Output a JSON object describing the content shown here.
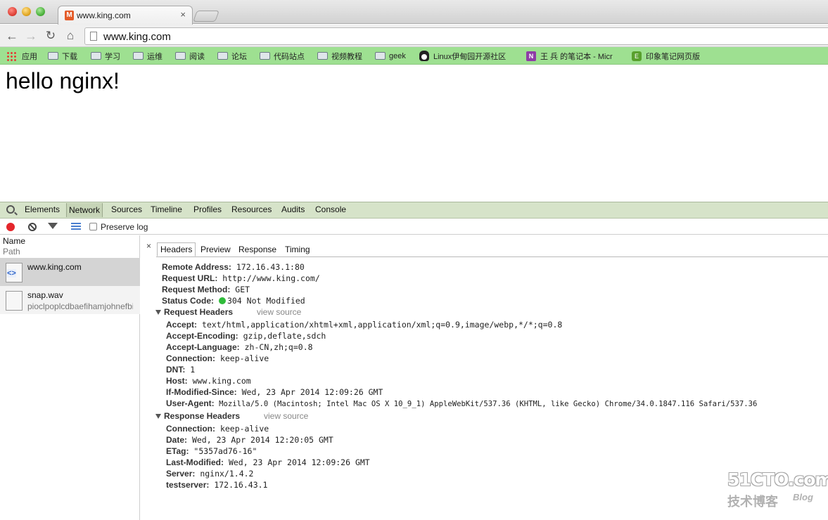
{
  "browser": {
    "tab_title": "www.king.com",
    "tab_close": "×",
    "url": "www.king.com"
  },
  "bookmarks": [
    {
      "label": "应用",
      "icon": "apps-grid-icon"
    },
    {
      "label": "下载",
      "icon": "folder-icon"
    },
    {
      "label": "学习",
      "icon": "folder-icon"
    },
    {
      "label": "运维",
      "icon": "folder-icon"
    },
    {
      "label": "阅读",
      "icon": "folder-icon"
    },
    {
      "label": "论坛",
      "icon": "folder-icon"
    },
    {
      "label": "代码站点",
      "icon": "folder-icon"
    },
    {
      "label": "视频教程",
      "icon": "folder-icon"
    },
    {
      "label": "geek",
      "icon": "folder-icon"
    },
    {
      "label": "Linux伊甸园开源社区",
      "icon": "penguin-icon"
    },
    {
      "label": "王 兵 的笔记本 - Micr",
      "icon": "onenote-icon"
    },
    {
      "label": "印象笔记网页版",
      "icon": "evernote-icon"
    }
  ],
  "page": {
    "heading": "hello nginx!"
  },
  "devtools": {
    "tabs": [
      "Elements",
      "Network",
      "Sources",
      "Timeline",
      "Profiles",
      "Resources",
      "Audits",
      "Console"
    ],
    "active_tab": "Network",
    "preserve_log_label": "Preserve log",
    "preserve_log_checked": false,
    "columns": {
      "name": "Name",
      "path": "Path"
    },
    "requests": [
      {
        "name": "www.king.com",
        "sub": "",
        "selected": true
      },
      {
        "name": "snap.wav",
        "sub": "pioclpoplcdbaefihamjohnefbikjilc",
        "selected": false
      }
    ],
    "detail_close": "×",
    "detail_tabs": [
      "Headers",
      "Preview",
      "Response",
      "Timing"
    ],
    "active_detail_tab": "Headers",
    "general": [
      {
        "key": "Remote Address:",
        "value": "172.16.43.1:80"
      },
      {
        "key": "Request URL:",
        "value": "http://www.king.com/"
      },
      {
        "key": "Request Method:",
        "value": "GET"
      },
      {
        "key": "Status Code:",
        "value": "304 Not Modified"
      }
    ],
    "request_headers_title": "Request Headers",
    "view_source_label": "view source",
    "request_headers": [
      {
        "key": "Accept:",
        "value": "text/html,application/xhtml+xml,application/xml;q=0.9,image/webp,*/*;q=0.8"
      },
      {
        "key": "Accept-Encoding:",
        "value": "gzip,deflate,sdch"
      },
      {
        "key": "Accept-Language:",
        "value": "zh-CN,zh;q=0.8"
      },
      {
        "key": "Connection:",
        "value": "keep-alive"
      },
      {
        "key": "DNT:",
        "value": "1"
      },
      {
        "key": "Host:",
        "value": "www.king.com"
      },
      {
        "key": "If-Modified-Since:",
        "value": "Wed, 23 Apr 2014 12:09:26 GMT"
      },
      {
        "key": "User-Agent:",
        "value": "Mozilla/5.0 (Macintosh; Intel Mac OS X 10_9_1) AppleWebKit/537.36 (KHTML, like Gecko) Chrome/34.0.1847.116 Safari/537.36"
      }
    ],
    "response_headers_title": "Response Headers",
    "response_headers": [
      {
        "key": "Connection:",
        "value": "keep-alive"
      },
      {
        "key": "Date:",
        "value": "Wed, 23 Apr 2014 12:20:05 GMT"
      },
      {
        "key": "ETag:",
        "value": "\"5357ad76-16\""
      },
      {
        "key": "Last-Modified:",
        "value": "Wed, 23 Apr 2014 12:09:26 GMT"
      },
      {
        "key": "Server:",
        "value": "nginx/1.4.2"
      },
      {
        "key": "testserver:",
        "value": "172.16.43.1"
      }
    ],
    "status_color": "#2fbb3a"
  },
  "watermark": {
    "brand": "51CTO.com",
    "sub": "技术博客",
    "blog": "Blog"
  }
}
